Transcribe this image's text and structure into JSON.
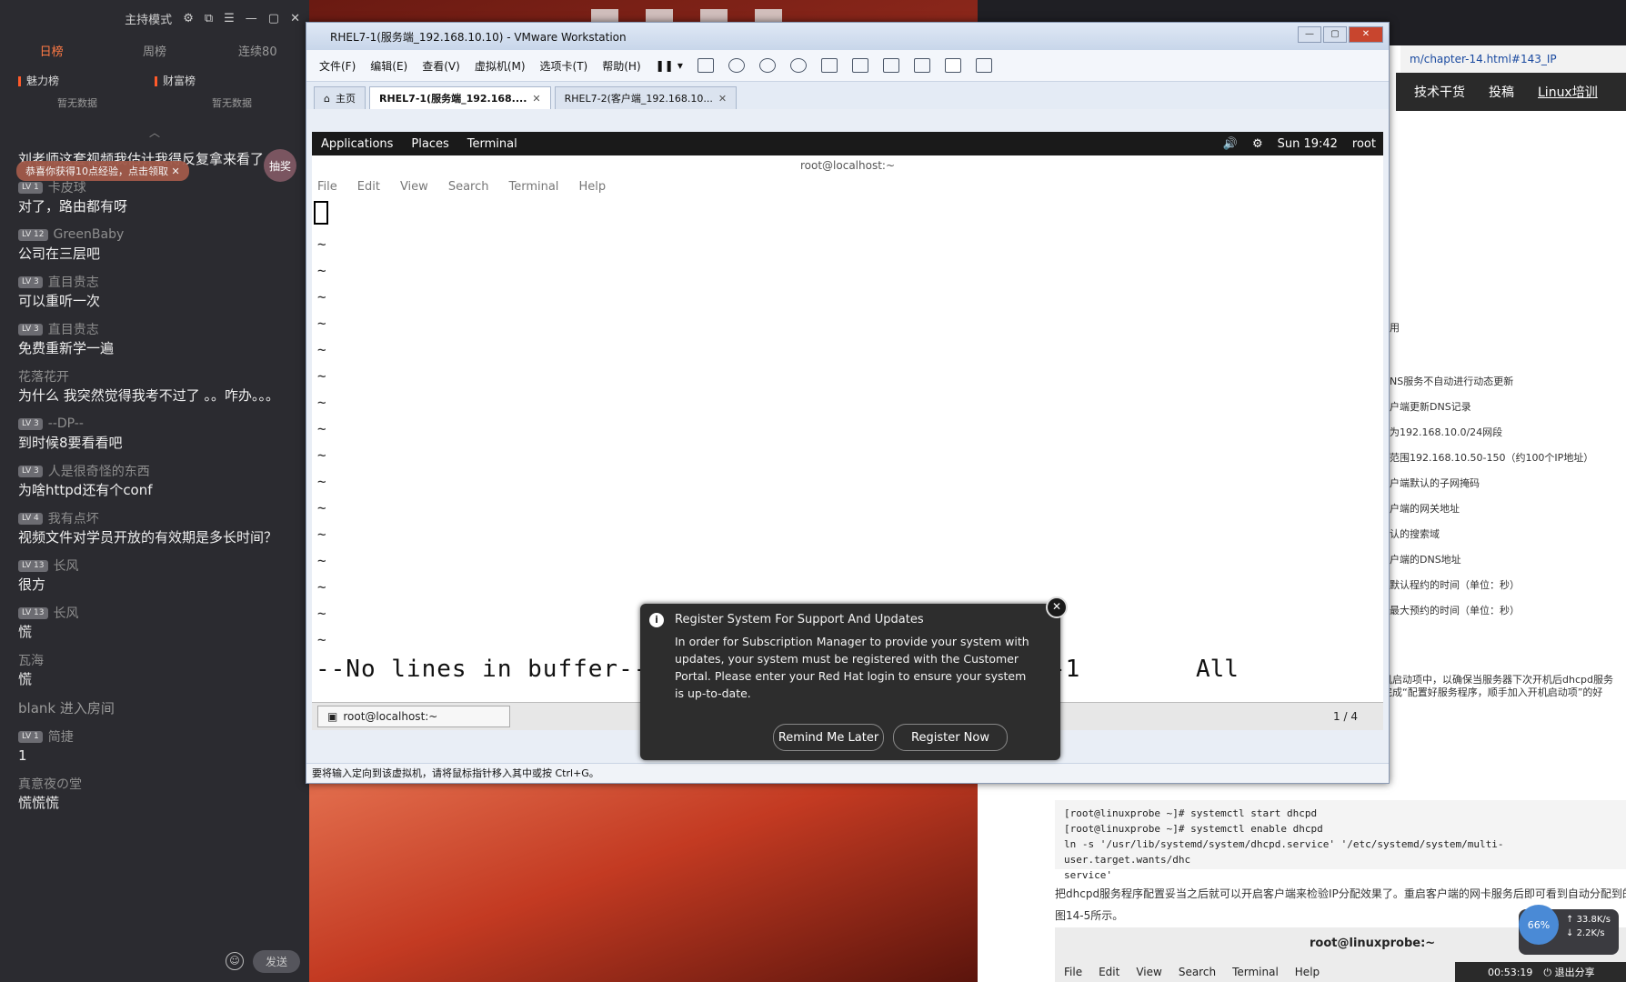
{
  "chat": {
    "titlebar": {
      "mode": "主持模式"
    },
    "tabs": [
      "日榜",
      "周榜",
      "连续80"
    ],
    "ranks": [
      {
        "label": "魅力榜",
        "empty": "暂无数据"
      },
      {
        "label": "财富榜",
        "empty": "暂无数据"
      }
    ],
    "toast": "恭喜你获得10点经验，点击领取",
    "lottery": "抽奖",
    "messages": [
      {
        "user": "",
        "level": "",
        "text": "刘老师这套视频我估计我得反复拿来看了"
      },
      {
        "user": "卡皮球",
        "level": "LV 1",
        "text": "对了，路由都有呀"
      },
      {
        "user": "GreenBaby",
        "level": "LV 12",
        "text": "公司在三层吧"
      },
      {
        "user": "直目贵志",
        "level": "LV 3",
        "text": "可以重听一次"
      },
      {
        "user": "直目贵志",
        "level": "LV 3",
        "text": "免费重新学一遍"
      },
      {
        "user": "花落花开",
        "level": "",
        "text": "为什么 我突然觉得我考不过了 。。咋办。。。"
      },
      {
        "user": "--DP--",
        "level": "LV 3",
        "text": "到时候8要看看吧"
      },
      {
        "user": "人是很奇怪的东西",
        "level": "LV 3",
        "text": "为啥httpd还有个conf"
      },
      {
        "user": "我有点坏",
        "level": "LV 4",
        "text": "视频文件对学员开放的有效期是多长时间？"
      },
      {
        "user": "长风",
        "level": "LV 13",
        "text": "很方"
      },
      {
        "user": "长风",
        "level": "LV 13",
        "text": "慌"
      },
      {
        "user": "瓦海",
        "level": "",
        "text": "慌"
      },
      {
        "user": "",
        "level": "",
        "text": "blank 进入房间",
        "system": true
      },
      {
        "user": "简捷",
        "level": "LV 1",
        "text": "1"
      },
      {
        "user": "真意夜の堂",
        "level": "",
        "text": "慌慌慌"
      }
    ],
    "send_label": "发送"
  },
  "browser": {
    "url": "m/chapter-14.html#143_IP",
    "nav": [
      "技术干货",
      "投稿",
      "Linux培训"
    ],
    "doc_lines": [
      "用",
      "NS服务不自动进行动态更新",
      "户端更新DNS记录",
      "为192.168.10.0/24网段",
      "范围192.168.10.50-150（约100个IP地址）",
      "户端默认的子网掩码",
      "户端的网关地址",
      "认的搜索域",
      "户端的DNS地址",
      "默认程约的时间（单位：秒）",
      "最大预约的时间（单位：秒）",
      "机启动项中，以确保当服务器下次开机后dhcpd服务",
      "完成“配置好服务程序，顺手加入开机启动项”的好"
    ],
    "code": [
      "[root@linuxprobe ~]# systemctl start dhcpd",
      "[root@linuxprobe ~]# systemctl enable dhcpd",
      " ln -s '/usr/lib/systemd/system/dhcpd.service' '/etc/systemd/system/multi-user.target.wants/dhc",
      "service'"
    ],
    "para1": "把dhcpd服务程序配置妥当之后就可以开启客户端来检验IP分配效果了。重启客户端的网卡服务后即可看到自动分配到的IP地",
    "para2": "图14-5所示。",
    "mini_term": {
      "title": "root@linuxprobe:~",
      "menu": [
        "File",
        "Edit",
        "View",
        "Search",
        "Terminal",
        "Help"
      ]
    },
    "speed": {
      "percent": "66%",
      "up": "33.8K/s",
      "down": "2.2K/s"
    },
    "recording": {
      "time": "00:53:19",
      "exit": "退出分享"
    }
  },
  "vmware": {
    "title": "RHEL7-1(服务端_192.168.10.10) - VMware Workstation",
    "menu": [
      "文件(F)",
      "编辑(E)",
      "查看(V)",
      "虚拟机(M)",
      "选项卡(T)",
      "帮助(H)"
    ],
    "tabs": [
      "主页",
      "RHEL7-1(服务端_192.168....",
      "RHEL7-2(客户端_192.168.10..."
    ],
    "status": "要将输入定向到该虚拟机，请将鼠标指针移入其中或按 Ctrl+G。",
    "guest": {
      "topbar": {
        "applications": "Applications",
        "places": "Places",
        "terminal": "Terminal",
        "clock": "Sun 19:42",
        "user": "root"
      },
      "term_title": "root@localhost:~",
      "term_menu": [
        "File",
        "Edit",
        "View",
        "Search",
        "Terminal",
        "Help"
      ],
      "tilde": "~",
      "status_left": "--No lines in buffer--",
      "status_pos": "0,0-1",
      "status_all": "All",
      "taskbar_item": "root@localhost:~",
      "pager": "1 / 4"
    }
  },
  "notification": {
    "title": "Register System For Support And Updates",
    "body": "In order for Subscription Manager to provide your system with updates, your system must be registered with the Customer Portal. Please enter your Red Hat login to ensure your system is up-to-date.",
    "remind_label": "Remind Me Later",
    "register_label": "Register Now"
  }
}
